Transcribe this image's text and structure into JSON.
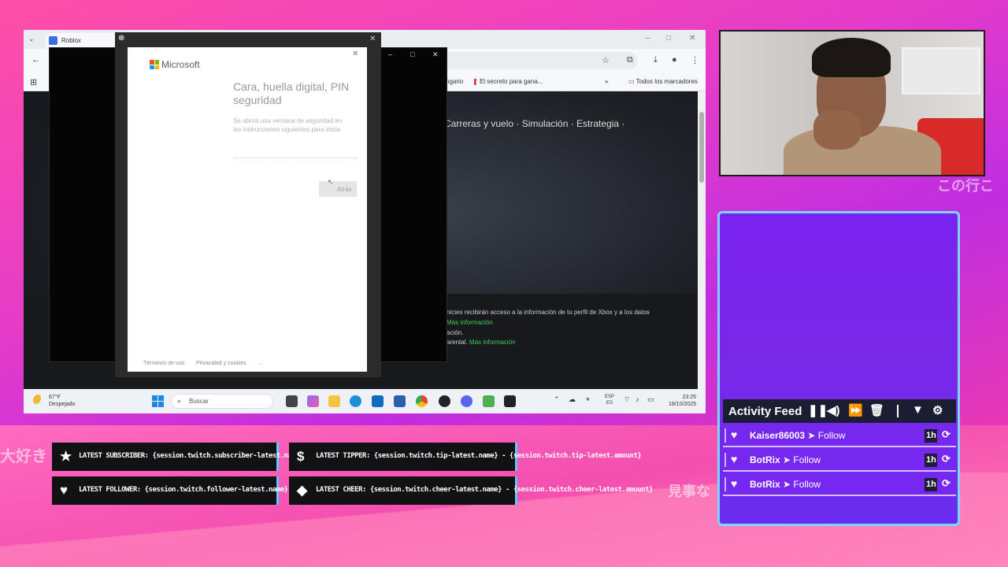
{
  "browser": {
    "tab_title": "Roblox",
    "bookmarks": [
      {
        "label": "ngario"
      },
      {
        "label": "El secreto para gana..."
      },
      {
        "label": "»"
      },
      {
        "label": "Todos los marcadores"
      }
    ]
  },
  "page": {
    "categories": "Carreras y vuelo · Simulación · Estrategia ·",
    "legal_1": "nicies recibirán acceso a la información de tu perfil de Xbox y a los datos",
    "legal_2_link": "Más información",
    "legal_3": "ación.",
    "legal_4": "arental.",
    "legal_4_link": "Más información"
  },
  "ms_dialog": {
    "brand": "Microsoft",
    "title": "Cara, huella digital, PIN\nseguridad",
    "description": "Se abrirá una ventana de seguridad en\nlas instrucciones siguientes para inicia",
    "back_button": "Atrás",
    "footer_terms": "Términos de uso",
    "footer_privacy": "Privacidad y cookies",
    "footer_more": "...",
    "logo_colors": [
      "#f25022",
      "#7fba00",
      "#00a4ef",
      "#ffb900"
    ]
  },
  "taskbar": {
    "weather_temp": "67°F",
    "weather_desc": "Despejado",
    "search_placeholder": "Buscar",
    "lang_1": "ESP",
    "lang_2": "ES",
    "time": "23:25",
    "date": "18/10/2025"
  },
  "activity_feed": {
    "title": "Activity Feed",
    "items": [
      {
        "user": "Kaiser86003",
        "action": "➤ Follow",
        "time": "1h"
      },
      {
        "user": "BotRix",
        "action": "➤ Follow",
        "time": "1h"
      },
      {
        "user": "BotRix",
        "action": "➤ Follow",
        "time": "1h"
      }
    ]
  },
  "alerts": {
    "subscriber": "LATEST SUBSCRIBER: {session.twitch.subscriber-latest.name}",
    "tipper": "LATEST TIPPER: {session.twitch.tip-latest.name} - {session.twitch.tip-latest.amount}",
    "follower": "LATEST FOLLOWER: {session.twitch.follower-latest.name}",
    "cheer": "LATEST CHEER: {session.twitch.cheer-latest.name} - {session.twitch.cheer-latest.amount}"
  },
  "overlay_text": {
    "jp_left": "大好き",
    "jp_right_top": "この行こ",
    "jp_right_bottom": "見事な"
  },
  "colors": {
    "accent_pink": "#ff4fa8",
    "feed_purple": "#7a22f0",
    "feed_border": "#7ad6ff",
    "link_green": "#3ecf5a"
  }
}
